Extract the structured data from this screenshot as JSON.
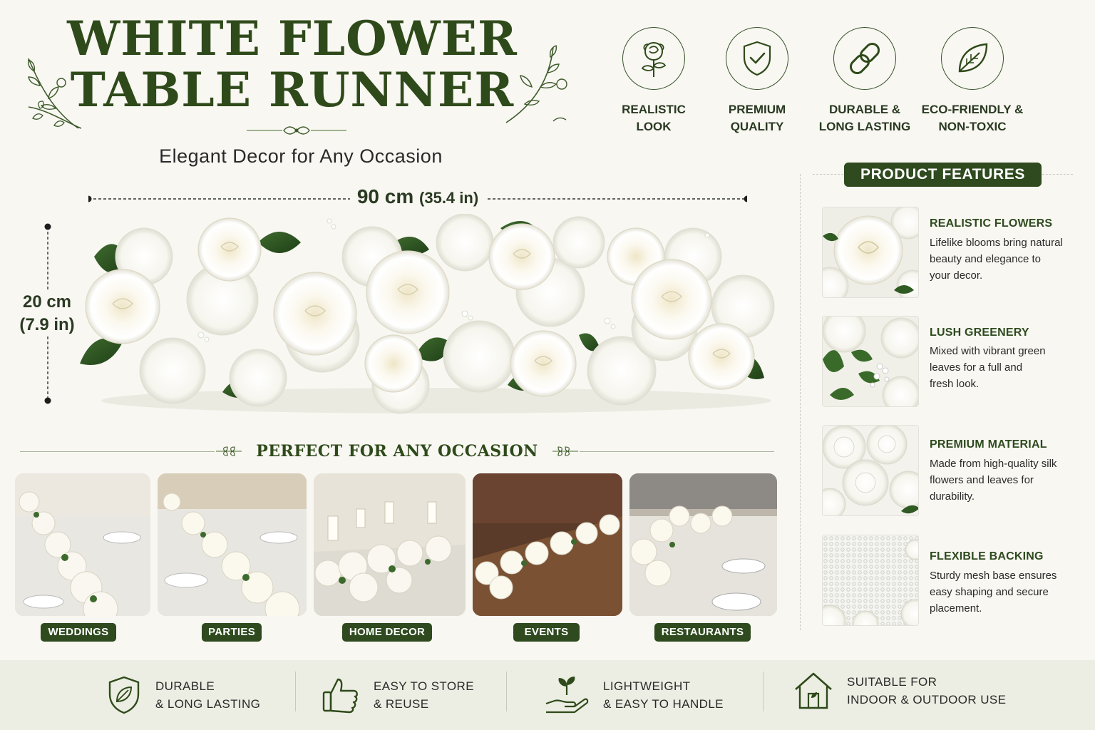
{
  "header": {
    "title_line1": "WHITE FLOWER",
    "title_line2": "TABLE RUNNER",
    "subtitle": "Elegant Decor  for Any Occasion"
  },
  "top_features": [
    {
      "icon": "rose-icon",
      "line1": "REALISTIC",
      "line2": "LOOK"
    },
    {
      "icon": "shield-check-icon",
      "line1": "PREMIUM",
      "line2": "QUALITY"
    },
    {
      "icon": "chain-link-icon",
      "line1": "DURABLE &",
      "line2": "LONG LASTING"
    },
    {
      "icon": "leaf-icon",
      "line1": "ECO-FRIENDLY &",
      "line2": "NON-TOXIC"
    }
  ],
  "dimensions": {
    "length_cm": "90 cm",
    "length_in": "(35.4 in)",
    "width_cm": "20 cm",
    "width_in": "(7.9 in)"
  },
  "occasions": {
    "heading": "PERFECT FOR ANY OCCASION",
    "items": [
      "WEDDINGS",
      "PARTIES",
      "HOME DECOR",
      "EVENTS",
      "RESTAURANTS"
    ]
  },
  "product_features": {
    "heading": "PRODUCT FEATURES",
    "items": [
      {
        "title": "REALISTIC FLOWERS",
        "line1": "Lifelike blooms bring natural",
        "line2": "beauty and elegance to",
        "line3": "your decor."
      },
      {
        "title": "LUSH GREENERY",
        "line1": "Mixed with vibrant green",
        "line2": "leaves for a full and",
        "line3": "fresh look."
      },
      {
        "title": "PREMIUM MATERIAL",
        "line1": "Made from high-quality silk",
        "line2": "flowers and leaves for",
        "line3": "durability."
      },
      {
        "title": "FLEXIBLE BACKING",
        "line1": "Sturdy mesh base ensures",
        "line2": "easy shaping and secure",
        "line3": "placement."
      }
    ]
  },
  "bottom_bar": [
    {
      "icon": "shield-leaf-icon",
      "line1": "DURABLE",
      "line2": "& LONG LASTING"
    },
    {
      "icon": "thumbs-up-icon",
      "line1": "EASY TO STORE",
      "line2": "& REUSE"
    },
    {
      "icon": "hand-sprout-icon",
      "line1": "LIGHTWEIGHT",
      "line2": "& EASY TO HANDLE"
    },
    {
      "icon": "house-icon",
      "line1": "SUITABLE FOR",
      "line2": "INDOOR & OUTDOOR USE"
    }
  ],
  "colors": {
    "brand_green": "#2e4a1e",
    "background": "#f8f7f2",
    "bottom_bar": "#eceee3"
  }
}
